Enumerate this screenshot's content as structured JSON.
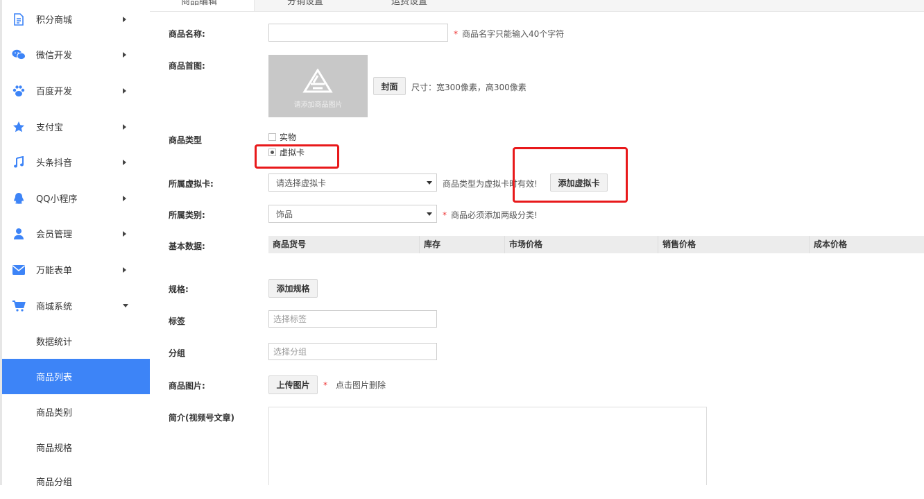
{
  "sidebar": {
    "items": [
      {
        "label": "积分商城",
        "icon": "document-icon",
        "expanded": false
      },
      {
        "label": "微信开发",
        "icon": "wechat-icon",
        "expanded": false
      },
      {
        "label": "百度开发",
        "icon": "paw-icon",
        "expanded": false
      },
      {
        "label": "支付宝",
        "icon": "star-icon",
        "expanded": false
      },
      {
        "label": "头条抖音",
        "icon": "music-note-icon",
        "expanded": false
      },
      {
        "label": "QQ小程序",
        "icon": "qq-icon",
        "expanded": false
      },
      {
        "label": "会员管理",
        "icon": "user-icon",
        "expanded": false
      },
      {
        "label": "万能表单",
        "icon": "envelope-icon",
        "expanded": false
      },
      {
        "label": "商城系统",
        "icon": "cart-icon",
        "expanded": true
      }
    ],
    "sub_items": [
      {
        "label": "数据统计",
        "active": false
      },
      {
        "label": "商品列表",
        "active": true
      },
      {
        "label": "商品类别",
        "active": false
      },
      {
        "label": "商品规格",
        "active": false
      },
      {
        "label": "商品分组",
        "active": false
      }
    ]
  },
  "tabs": [
    {
      "label": "商品编辑",
      "active": true
    },
    {
      "label": "分销设置",
      "active": false
    },
    {
      "label": "运费设置",
      "active": false
    }
  ],
  "form": {
    "name": {
      "label": "商品名称:",
      "value": "",
      "hint": "商品名字只能输入40个字符",
      "required": "*"
    },
    "cover": {
      "label": "商品首图:",
      "placeholder_text": "请添加商品图片",
      "button": "封面",
      "hint": "尺寸：宽300像素，高300像素"
    },
    "type": {
      "label": "商品类型",
      "options": [
        {
          "label": "实物",
          "checked": false
        },
        {
          "label": "虚拟卡",
          "checked": true
        }
      ]
    },
    "virtual_card": {
      "label": "所属虚拟卡:",
      "selected": "请选择虚拟卡",
      "hint": "商品类型为虚拟卡时有效!",
      "button": "添加虚拟卡"
    },
    "category": {
      "label": "所属类别:",
      "selected": "饰品",
      "required": "*",
      "hint": "商品必须添加两级分类!"
    },
    "basic": {
      "label": "基本数据:",
      "columns": [
        "商品货号",
        "库存",
        "市场价格",
        "销售价格",
        "成本价格"
      ]
    },
    "spec": {
      "label": "规格:",
      "button": "添加规格"
    },
    "tag": {
      "label": "标签",
      "placeholder": "选择标签"
    },
    "group": {
      "label": "分组",
      "placeholder": "选择分组"
    },
    "images": {
      "label": "商品图片:",
      "button": "上传图片",
      "required": "*",
      "hint": "点击图片删除"
    },
    "intro": {
      "label": "简介(视频号文章)"
    }
  },
  "colors": {
    "accent": "#3d84f7",
    "annotation": "#e8191b",
    "required": "#e33333"
  }
}
